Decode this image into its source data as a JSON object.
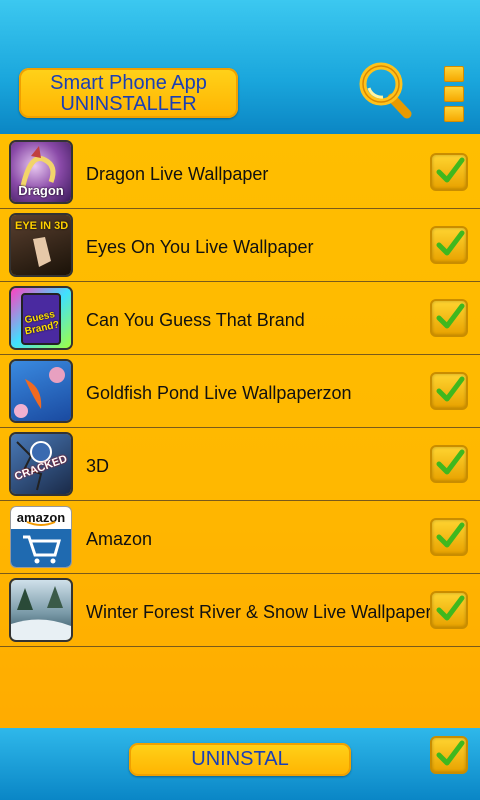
{
  "header": {
    "title_line1": "Smart Phone App",
    "title_line2": "UNINSTALLER",
    "search_icon": "search-icon",
    "menu_icon": "menu-icon"
  },
  "apps": [
    {
      "label": "Dragon Live Wallpaper",
      "thumb_caption": "Dragon",
      "checked": true
    },
    {
      "label": "Eyes On You Live Wallpaper",
      "thumb_caption": "EYE IN 3D",
      "checked": true
    },
    {
      "label": "Can You Guess That Brand",
      "thumb_caption": "Guess Brand?",
      "checked": true
    },
    {
      "label": "Goldfish Pond Live Wallpaperzon",
      "thumb_caption": "",
      "checked": true
    },
    {
      "label": "3D",
      "thumb_caption": "CRACKED",
      "checked": true
    },
    {
      "label": "Amazon",
      "thumb_caption": "amazon",
      "checked": true
    },
    {
      "label": "Winter Forest River & Snow Live Wallpaper",
      "thumb_caption": "",
      "checked": true
    }
  ],
  "footer": {
    "uninstall_label": "UNINSTAL",
    "select_all_checked": true
  },
  "colors": {
    "header_blue": "#1aa6dc",
    "list_orange": "#ffb800",
    "button_text": "#1a3fb5",
    "check_green": "#3fb81e"
  }
}
